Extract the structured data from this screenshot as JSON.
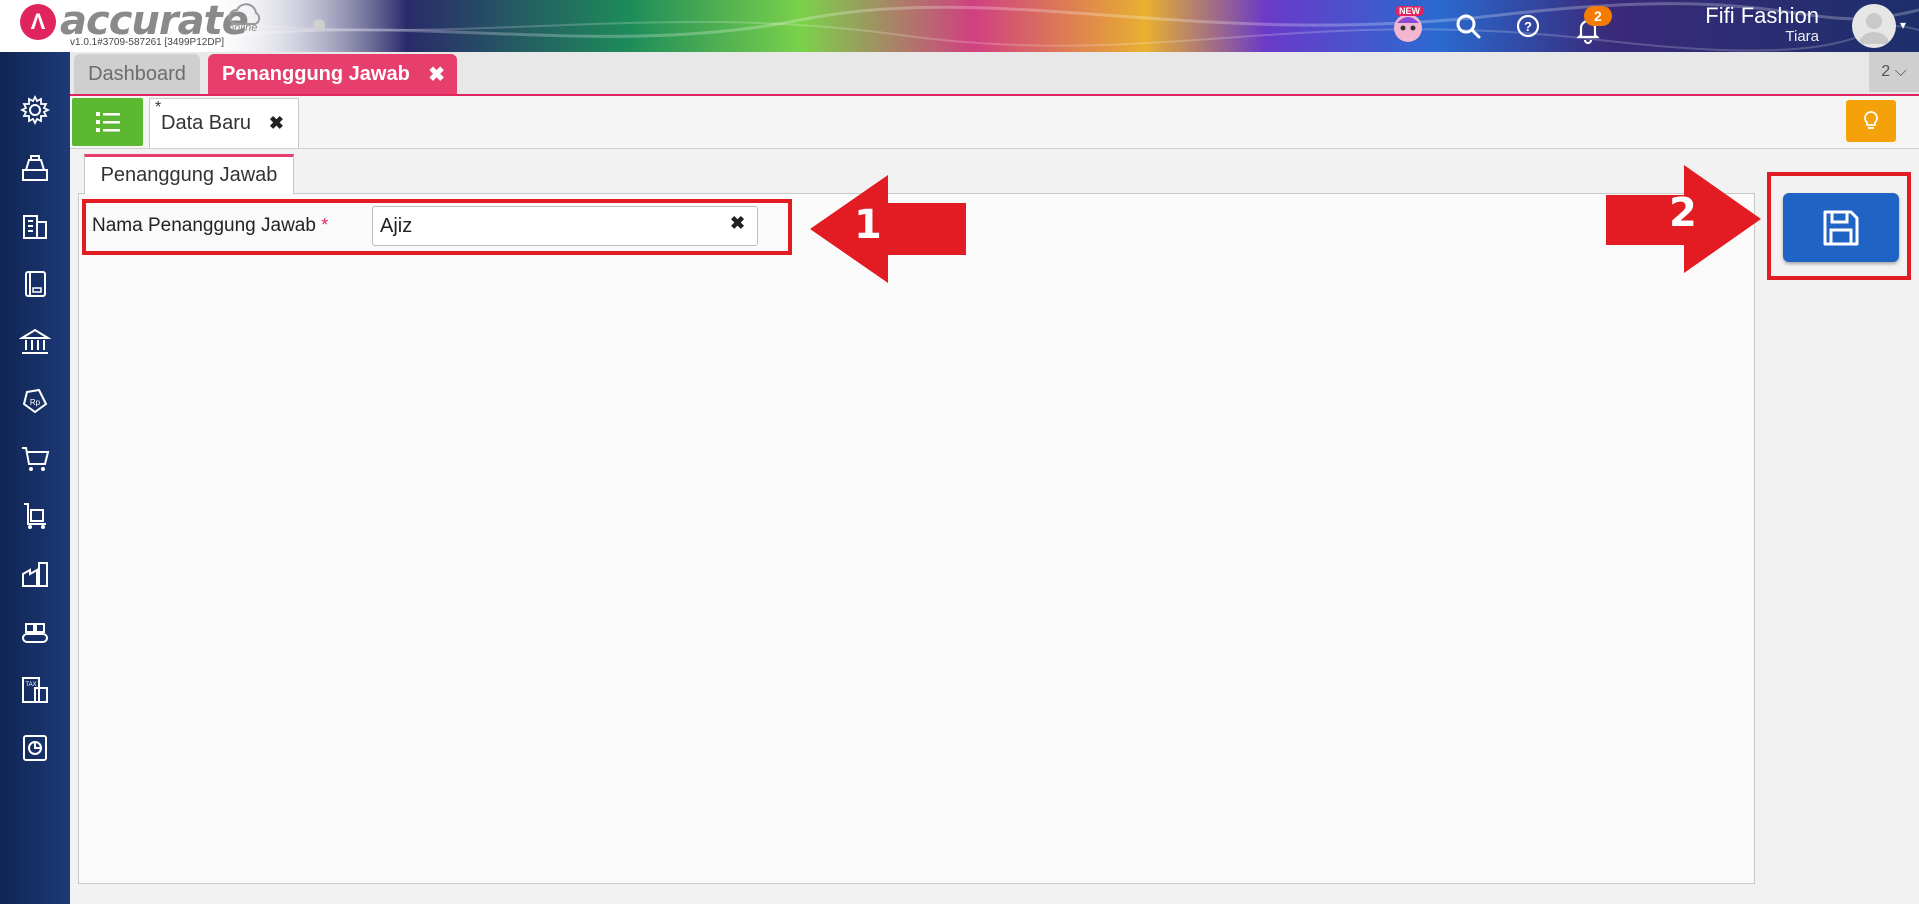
{
  "app": {
    "logo_mark": "Λ",
    "logo_text": "accurate",
    "logo_sub": "online",
    "version": "v1.0.1#3709-587261 [3499P12DP]"
  },
  "header": {
    "new_badge": "NEW",
    "notification_count": "2",
    "company": "Fifi Fashion",
    "username": "Tiara"
  },
  "tabs": {
    "dashboard": "Dashboard",
    "active": "Penanggung Jawab",
    "close_glyph": "✖",
    "overflow": "2 ⌵"
  },
  "subtabs": {
    "modified_marker": "*",
    "data_baru": "Data Baru",
    "close_glyph": "✖"
  },
  "form": {
    "section_tab": "Penanggung Jawab",
    "field_label": "Nama Penanggung Jawab",
    "required_marker": "*",
    "field_value": "Ajiz",
    "clear_glyph": "✖"
  },
  "annotations": {
    "step1": "1",
    "step2": "2",
    "color": "#e31b23"
  },
  "colors": {
    "accent_pink": "#e63e6d",
    "save_blue": "#1f63c4",
    "list_green": "#5bb830",
    "bulb_orange": "#f5a20a",
    "sidebar_navy": "#1d3a78"
  },
  "sidebar_icons": [
    "gear-icon",
    "cash-register-icon",
    "building-icon",
    "book-icon",
    "bank-icon",
    "price-tag-icon",
    "cart-icon",
    "handcart-icon",
    "factory-icon",
    "conveyor-icon",
    "tax-icon",
    "report-chart-icon"
  ]
}
